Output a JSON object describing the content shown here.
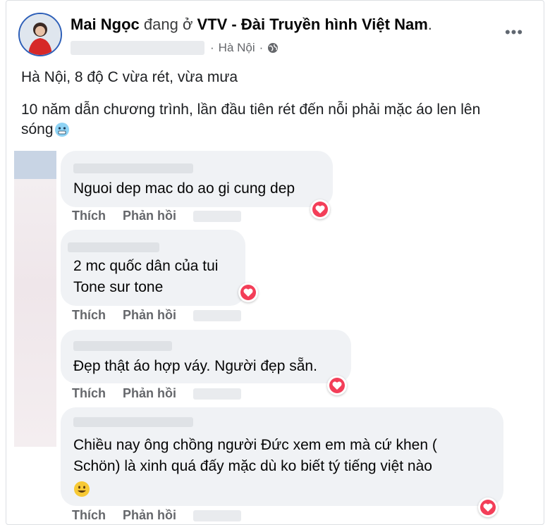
{
  "header": {
    "name": "Mai Ngọc",
    "checkin_verb": "đang ở",
    "place": "VTV - Đài Truyền hình Việt Nam",
    "place_suffix": ".",
    "location": "Hà Nội",
    "dot": "·"
  },
  "post": {
    "line1": "Hà Nội, 8 độ C vừa rét, vừa mưa",
    "line2": "10 năm dẫn chương trình, lần đầu tiên rét đến nỗi phải mặc áo len lên",
    "line3": "sóng"
  },
  "comments": [
    {
      "text_lines": [
        "Nguoi dep mac do ao gi cung dep"
      ],
      "like_label": "Thích",
      "reply_label": "Phản hồi"
    },
    {
      "text_lines": [
        "2 mc quốc dân của tui",
        "Tone sur tone"
      ],
      "like_label": "Thích",
      "reply_label": "Phản hồi"
    },
    {
      "text_lines": [
        "Đẹp thật áo hợp váy. Người đẹp sẵn."
      ],
      "like_label": "Thích",
      "reply_label": "Phản hồi"
    },
    {
      "text_lines": [
        "Chiều nay ông chồng người Đức xem em mà cứ khen (",
        "Schön) là xinh quá đấy mặc dù ko biết tý tiếng việt nào"
      ],
      "like_label": "Thích",
      "reply_label": "Phản hồi"
    }
  ],
  "icons": {
    "more": "more-options-icon",
    "globe": "globe-icon",
    "reaction": "heart-reaction-icon",
    "emoji_cold": "cold-face-emoji",
    "emoji_smile": "smile-emoji"
  },
  "colors": {
    "reaction": "#f33e58",
    "bubble": "#f0f2f5",
    "meta": "#65676b"
  }
}
